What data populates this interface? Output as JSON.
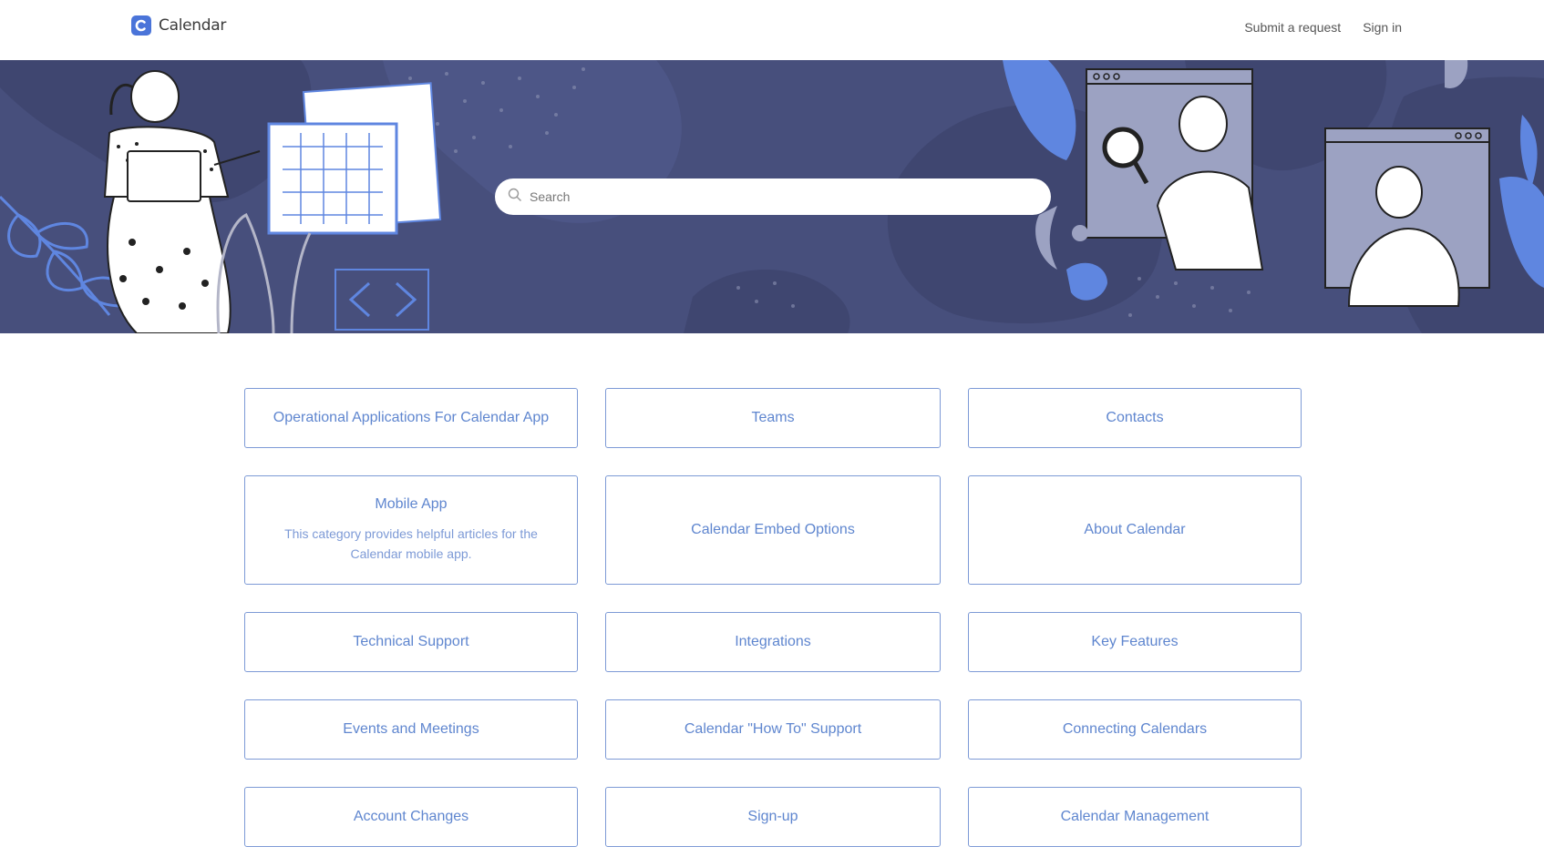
{
  "header": {
    "logo_text": "Calendar",
    "nav": {
      "submit_request": "Submit a request",
      "sign_in": "Sign in"
    }
  },
  "hero": {
    "search_placeholder": "Search"
  },
  "categories": [
    {
      "title": "Operational Applications For Calendar App",
      "description": ""
    },
    {
      "title": "Teams",
      "description": ""
    },
    {
      "title": "Contacts",
      "description": ""
    },
    {
      "title": "Mobile App",
      "description": "This category provides helpful articles for the Calendar mobile app."
    },
    {
      "title": "Calendar Embed Options",
      "description": ""
    },
    {
      "title": "About Calendar",
      "description": ""
    },
    {
      "title": "Technical Support",
      "description": ""
    },
    {
      "title": "Integrations",
      "description": ""
    },
    {
      "title": "Key Features",
      "description": ""
    },
    {
      "title": "Events and Meetings",
      "description": ""
    },
    {
      "title": "Calendar \"How To\" Support",
      "description": ""
    },
    {
      "title": "Connecting Calendars",
      "description": ""
    },
    {
      "title": "Account Changes",
      "description": ""
    },
    {
      "title": "Sign-up",
      "description": ""
    },
    {
      "title": "Calendar Management",
      "description": ""
    }
  ],
  "colors": {
    "brand": "#4a74d9",
    "hero_bg": "#474f7c",
    "card_border": "#7d9ad6",
    "card_text": "#5f86cf"
  }
}
